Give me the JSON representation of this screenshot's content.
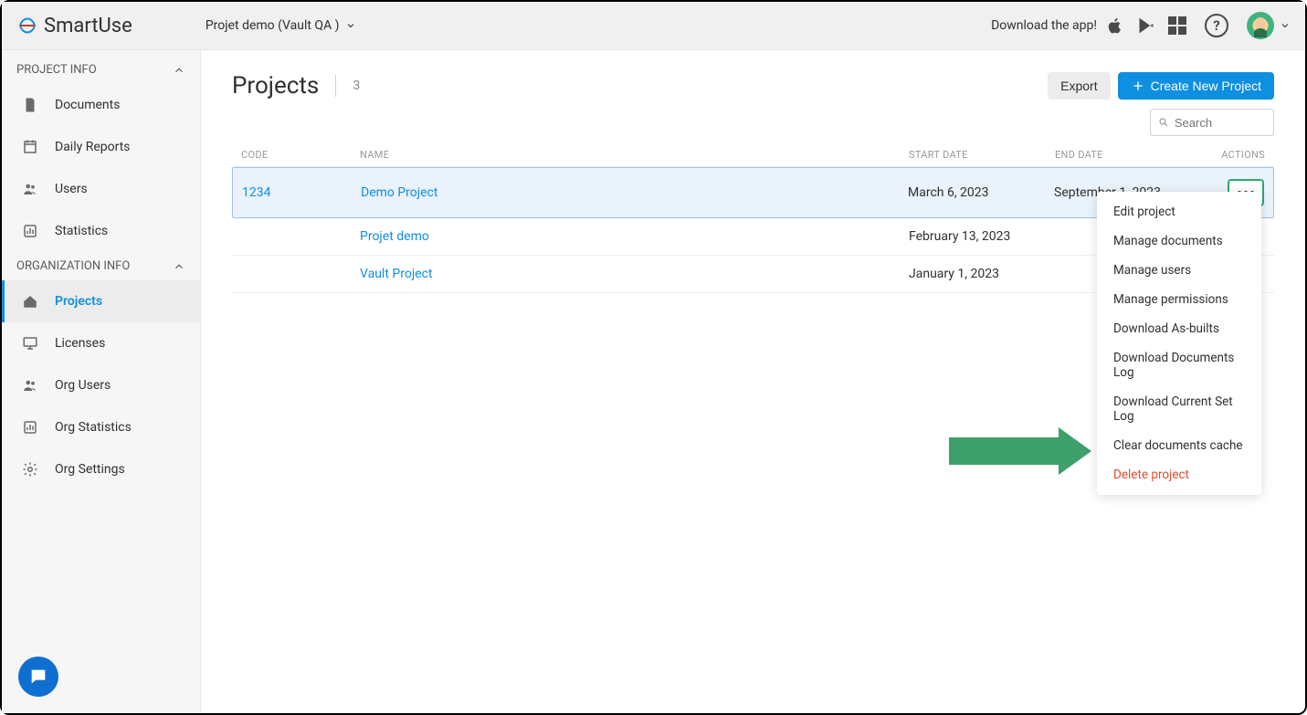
{
  "brand": "SmartUse",
  "header": {
    "project_switcher": "Projet demo (Vault QA )",
    "download_label": "Download the app!"
  },
  "sidebar": {
    "section1": "PROJECT INFO",
    "section2": "ORGANIZATION INFO",
    "items": {
      "documents": "Documents",
      "daily_reports": "Daily Reports",
      "users": "Users",
      "statistics": "Statistics",
      "projects": "Projects",
      "licenses": "Licenses",
      "org_users": "Org Users",
      "org_statistics": "Org Statistics",
      "org_settings": "Org Settings"
    }
  },
  "page": {
    "title": "Projects",
    "count": "3",
    "export_label": "Export",
    "create_label": "Create New Project",
    "search_placeholder": "Search"
  },
  "table": {
    "headers": {
      "code": "CODE",
      "name": "NAME",
      "start": "START DATE",
      "end": "END DATE",
      "actions": "ACTIONS"
    },
    "rows": [
      {
        "code": "1234",
        "name": "Demo Project",
        "start": "March 6, 2023",
        "end": "September 1, 2023"
      },
      {
        "code": "",
        "name": "Projet demo",
        "start": "February 13, 2023",
        "end": ""
      },
      {
        "code": "",
        "name": "Vault Project",
        "start": "January 1, 2023",
        "end": ""
      }
    ]
  },
  "menu": {
    "edit": "Edit project",
    "manage_docs": "Manage documents",
    "manage_users": "Manage users",
    "manage_perms": "Manage permissions",
    "dl_asbuilts": "Download As-builts",
    "dl_docs_log": "Download Documents Log",
    "dl_set_log": "Download Current Set Log",
    "clear_cache": "Clear documents cache",
    "delete": "Delete project"
  }
}
